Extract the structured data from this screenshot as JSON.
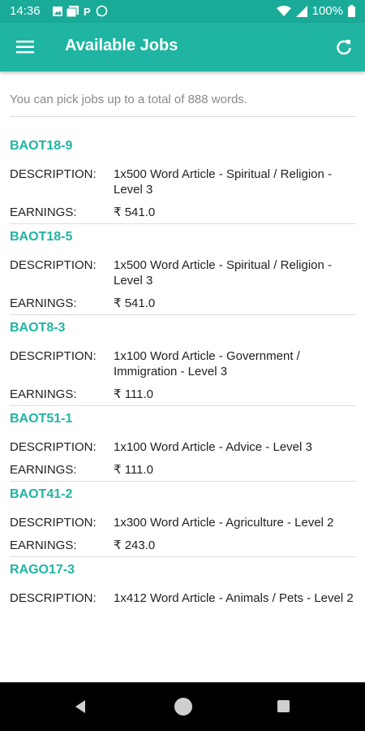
{
  "status_bar": {
    "time": "14:36",
    "battery": "100%",
    "notification_icons": [
      "image-icon",
      "photo-icon",
      "parking-icon",
      "whatsapp-icon"
    ]
  },
  "app_bar": {
    "title": "Available Jobs",
    "menu_icon": "hamburger-menu-icon",
    "refresh_icon": "refresh-icon",
    "color": "#1fb5a2"
  },
  "info_text": "You can pick jobs up to a total of 888 words.",
  "labels": {
    "description": "DESCRIPTION:",
    "earnings": "EARNINGS:"
  },
  "jobs": [
    {
      "id": "BAOT18-9",
      "description": "1x500 Word Article - Spiritual / Religion - Level 3",
      "earnings": "₹ 541.0"
    },
    {
      "id": "BAOT18-5",
      "description": "1x500 Word Article - Spiritual / Religion - Level 3",
      "earnings": "₹ 541.0"
    },
    {
      "id": "BAOT8-3",
      "description": "1x100 Word Article - Government / Immigration - Level 3",
      "earnings": "₹ 111.0"
    },
    {
      "id": "BAOT51-1",
      "description": "1x100 Word Article - Advice - Level 3",
      "earnings": "₹ 111.0"
    },
    {
      "id": "BAOT41-2",
      "description": "1x300 Word Article - Agriculture - Level 2",
      "earnings": "₹ 243.0"
    },
    {
      "id": "RAGO17-3",
      "description": "1x412 Word Article - Animals / Pets - Level 2",
      "earnings": ""
    }
  ],
  "nav_bar": {
    "back_icon": "back-triangle-icon",
    "home_icon": "home-circle-icon",
    "recents_icon": "recents-square-icon"
  }
}
